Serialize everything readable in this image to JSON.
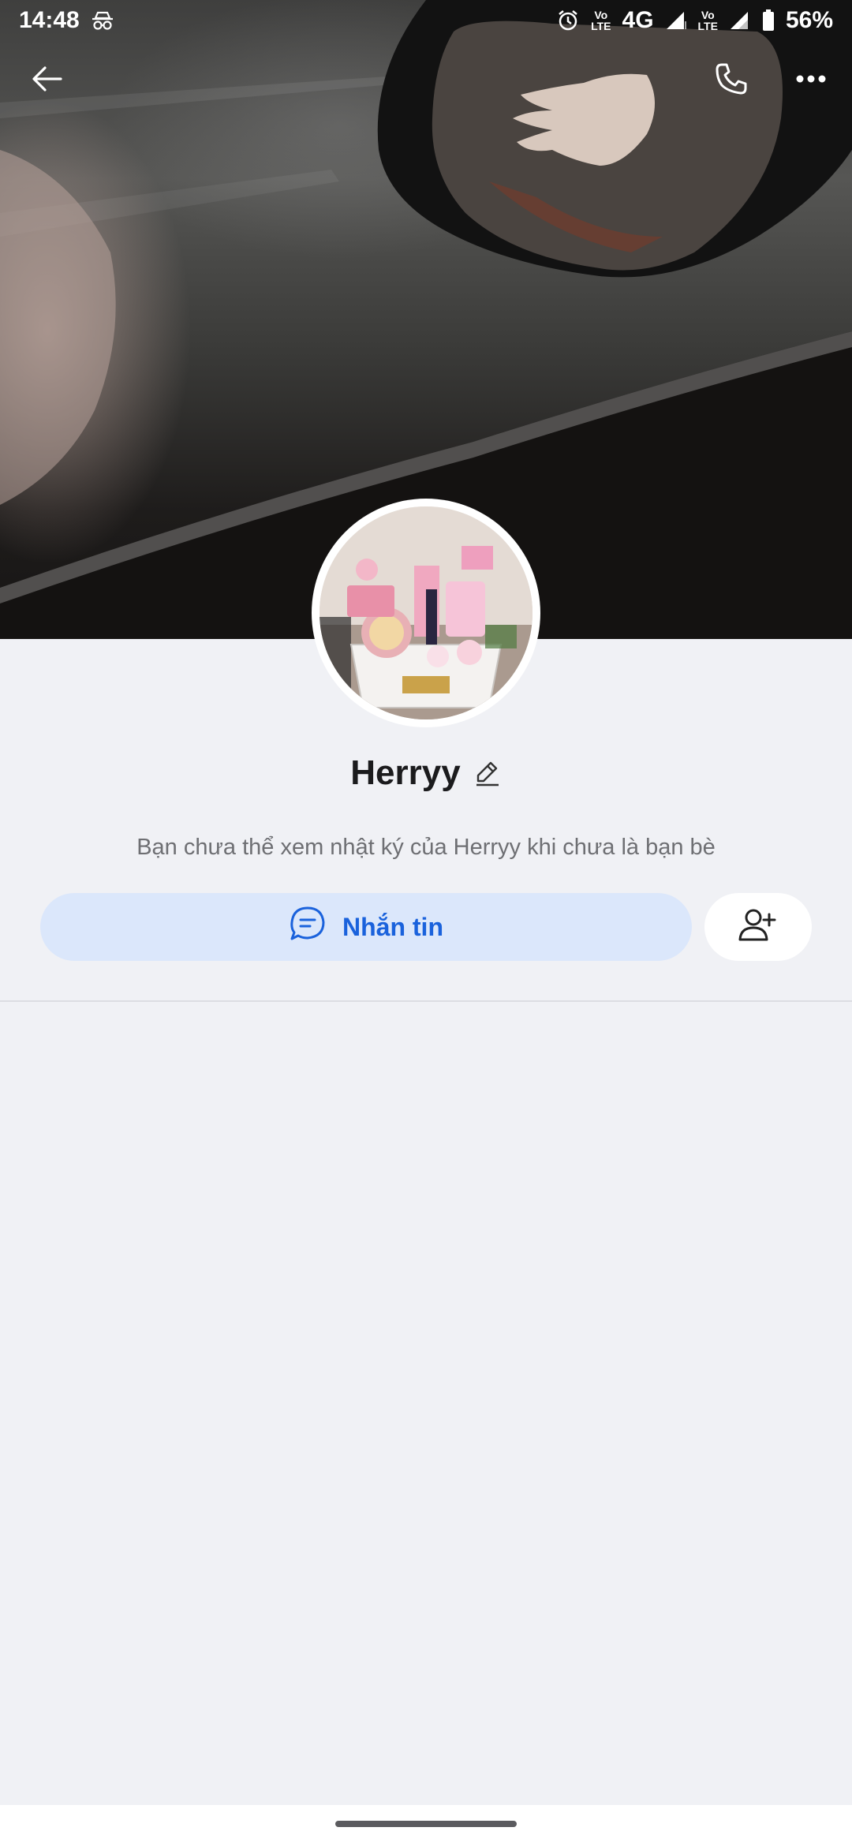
{
  "status_bar": {
    "time": "14:48",
    "network": "4G",
    "volte_top": "Vo",
    "volte_bottom": "LTE",
    "battery": "56%",
    "icons": [
      "incognito-icon",
      "alarm-icon",
      "volte-icon",
      "signal-icon",
      "battery-icon"
    ]
  },
  "header": {
    "back_icon": "arrow-left-icon",
    "call_icon": "phone-icon",
    "more_icon": "more-horizontal-icon"
  },
  "profile": {
    "name": "Herryy",
    "edit_icon": "pencil-icon",
    "privacy_note": "Bạn chưa thể xem nhật ký của Herryy khi chưa là bạn bè"
  },
  "actions": {
    "message_label": "Nhắn tin",
    "message_icon": "chat-bubble-icon",
    "add_friend_icon": "add-user-icon"
  },
  "colors": {
    "accent": "#1a62dc",
    "message_bg": "#dbe7fb",
    "page_bg": "#f0f1f5"
  }
}
